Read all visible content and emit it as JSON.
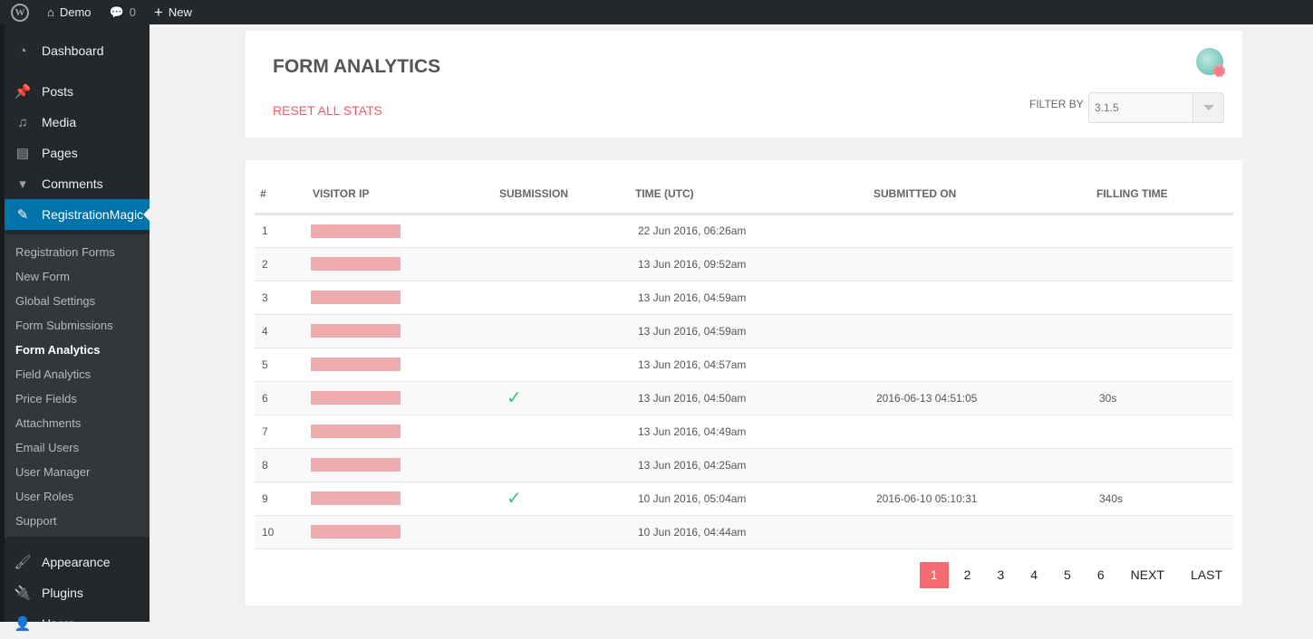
{
  "adminbar": {
    "site": "Demo",
    "comments": "0",
    "new": "New"
  },
  "menu": {
    "dashboard": "Dashboard",
    "posts": "Posts",
    "media": "Media",
    "pages": "Pages",
    "comments": "Comments",
    "plugin": "RegistrationMagic",
    "appearance": "Appearance",
    "plugins": "Plugins",
    "users": "Users"
  },
  "submenu": [
    "Registration Forms",
    "New Form",
    "Global Settings",
    "Form Submissions",
    "Form Analytics",
    "Field Analytics",
    "Price Fields",
    "Attachments",
    "Email Users",
    "User Manager",
    "User Roles",
    "Support"
  ],
  "header": {
    "title": "FORM ANALYTICS",
    "reset": "RESET ALL STATS",
    "filter_label": "FILTER BY",
    "filter_value": "3.1.5"
  },
  "table": {
    "columns": [
      "#",
      "VISITOR IP",
      "SUBMISSION",
      "TIME (UTC)",
      "SUBMITTED ON",
      "FILLING TIME"
    ],
    "rows": [
      {
        "n": "1",
        "submitted": false,
        "time": "22 Jun 2016, 06:26am",
        "on": "",
        "fill": ""
      },
      {
        "n": "2",
        "submitted": false,
        "time": "13 Jun 2016, 09:52am",
        "on": "",
        "fill": ""
      },
      {
        "n": "3",
        "submitted": false,
        "time": "13 Jun 2016, 04:59am",
        "on": "",
        "fill": ""
      },
      {
        "n": "4",
        "submitted": false,
        "time": "13 Jun 2016, 04:59am",
        "on": "",
        "fill": ""
      },
      {
        "n": "5",
        "submitted": false,
        "time": "13 Jun 2016, 04:57am",
        "on": "",
        "fill": ""
      },
      {
        "n": "6",
        "submitted": true,
        "time": "13 Jun 2016, 04:50am",
        "on": "2016-06-13 04:51:05",
        "fill": "30s"
      },
      {
        "n": "7",
        "submitted": false,
        "time": "13 Jun 2016, 04:49am",
        "on": "",
        "fill": ""
      },
      {
        "n": "8",
        "submitted": false,
        "time": "13 Jun 2016, 04:25am",
        "on": "",
        "fill": ""
      },
      {
        "n": "9",
        "submitted": true,
        "time": "10 Jun 2016, 05:04am",
        "on": "2016-06-10 05:10:31",
        "fill": "340s"
      },
      {
        "n": "10",
        "submitted": false,
        "time": "10 Jun 2016, 04:44am",
        "on": "",
        "fill": ""
      }
    ]
  },
  "pagination": {
    "pages": [
      "1",
      "2",
      "3",
      "4",
      "5",
      "6"
    ],
    "current": "1",
    "next": "NEXT",
    "last": "LAST"
  }
}
